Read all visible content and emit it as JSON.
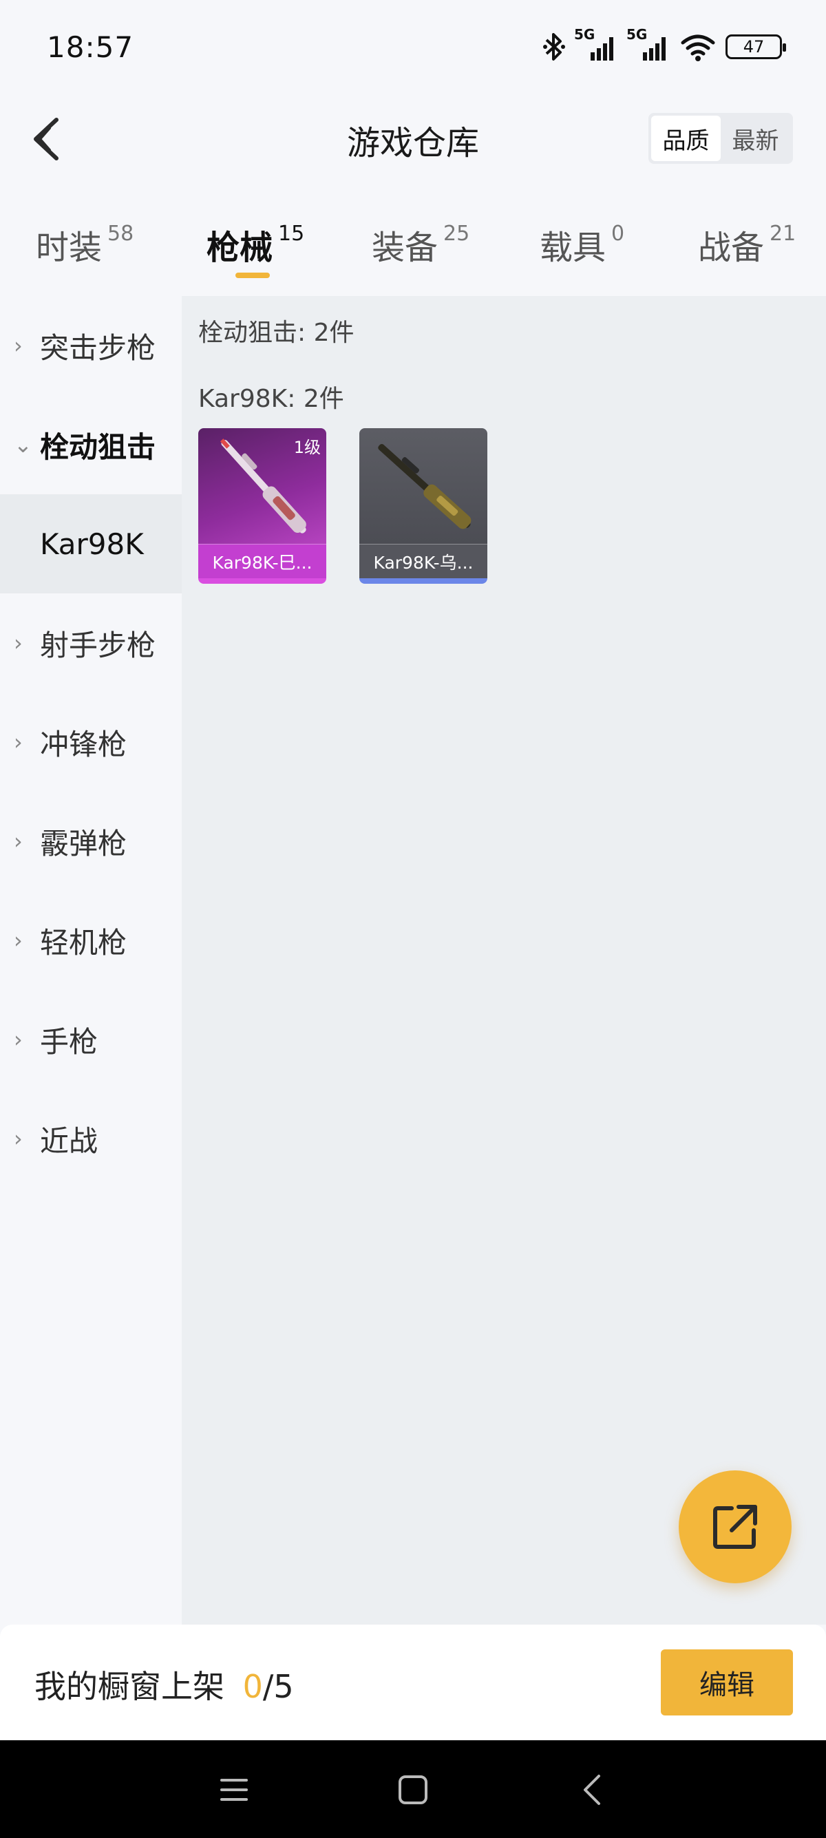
{
  "status_bar": {
    "time": "18:57",
    "network_1": "5G",
    "network_2": "5G",
    "battery": "47",
    "icons": [
      "bluetooth-icon",
      "signal-icon",
      "signal-icon",
      "wifi-icon",
      "battery-icon"
    ]
  },
  "header": {
    "title": "游戏仓库",
    "sort_options": [
      {
        "label": "品质",
        "active": true
      },
      {
        "label": "最新",
        "active": false
      }
    ]
  },
  "tabs": [
    {
      "label": "时装",
      "count": "58",
      "active": false
    },
    {
      "label": "枪械",
      "count": "15",
      "active": true
    },
    {
      "label": "装备",
      "count": "25",
      "active": false
    },
    {
      "label": "载具",
      "count": "0",
      "active": false
    },
    {
      "label": "战备",
      "count": "21",
      "active": false
    }
  ],
  "sidebar": {
    "items": [
      {
        "label": "突击步枪",
        "expanded": false
      },
      {
        "label": "栓动狙击",
        "expanded": true
      },
      {
        "label": "Kar98K",
        "sub": true,
        "selected": true
      },
      {
        "label": "射手步枪",
        "expanded": false
      },
      {
        "label": "冲锋枪",
        "expanded": false
      },
      {
        "label": "霰弹枪",
        "expanded": false
      },
      {
        "label": "轻机枪",
        "expanded": false
      },
      {
        "label": "手枪",
        "expanded": false
      },
      {
        "label": "近战",
        "expanded": false
      }
    ]
  },
  "content": {
    "category_heading": "栓动狙击: 2件",
    "group_heading": "Kar98K: 2件",
    "items": [
      {
        "name": "Kar98K-巳...",
        "level": "1级",
        "quality_color": "#d94ee0"
      },
      {
        "name": "Kar98K-乌...",
        "level": "",
        "quality_color": "#6b86e8"
      }
    ]
  },
  "bottom_bar": {
    "showcase_label": "我的橱窗上架",
    "showcase_count": "0",
    "showcase_total": "/5",
    "edit_label": "编辑"
  },
  "colors": {
    "accent": "#f1b53a",
    "purple_quality": "#d94ee0",
    "blue_quality": "#6b86e8"
  }
}
